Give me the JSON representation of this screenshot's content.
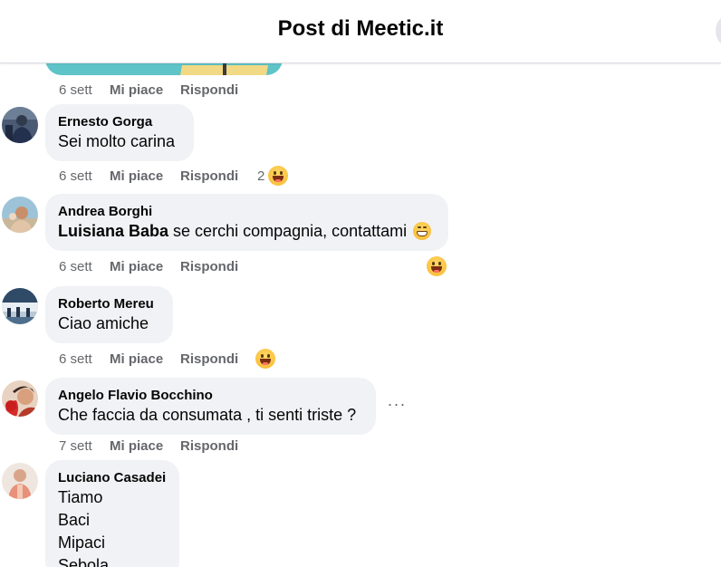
{
  "header": {
    "title": "Post di Meetic.it"
  },
  "comments": [
    {
      "time": "6 sett",
      "like": "Mi piace",
      "reply": "Rispondi"
    },
    {
      "author": "Ernesto Gorga",
      "text": "Sei molto carina",
      "time": "6 sett",
      "like": "Mi piace",
      "reply": "Rispondi",
      "reaction_count": "2",
      "reaction": "laughing-emoji"
    },
    {
      "author": "Andrea Borghi",
      "mention": "Luisiana Baba",
      "text": " se cerchi compagnia, contattami",
      "inline_emoji": "grinning-emoji",
      "time": "6 sett",
      "like": "Mi piace",
      "reply": "Rispondi",
      "reaction": "laughing-emoji"
    },
    {
      "author": "Roberto Mereu",
      "text": "Ciao amiche",
      "time": "6 sett",
      "like": "Mi piace",
      "reply": "Rispondi",
      "reaction": "laughing-emoji"
    },
    {
      "author": "Angelo Flavio Bocchino",
      "text": "Che faccia da consumata , ti senti triste ?",
      "time": "7 sett",
      "like": "Mi piace",
      "reply": "Rispondi",
      "more_label": "···"
    },
    {
      "author": "Luciano Casadei",
      "lines": [
        "Tiamo",
        "Baci",
        "Mipaci",
        "Sebola"
      ]
    }
  ],
  "colors": {
    "bubble": "#f0f2f5",
    "meta_text": "#65676b",
    "primary_text": "#050505"
  }
}
